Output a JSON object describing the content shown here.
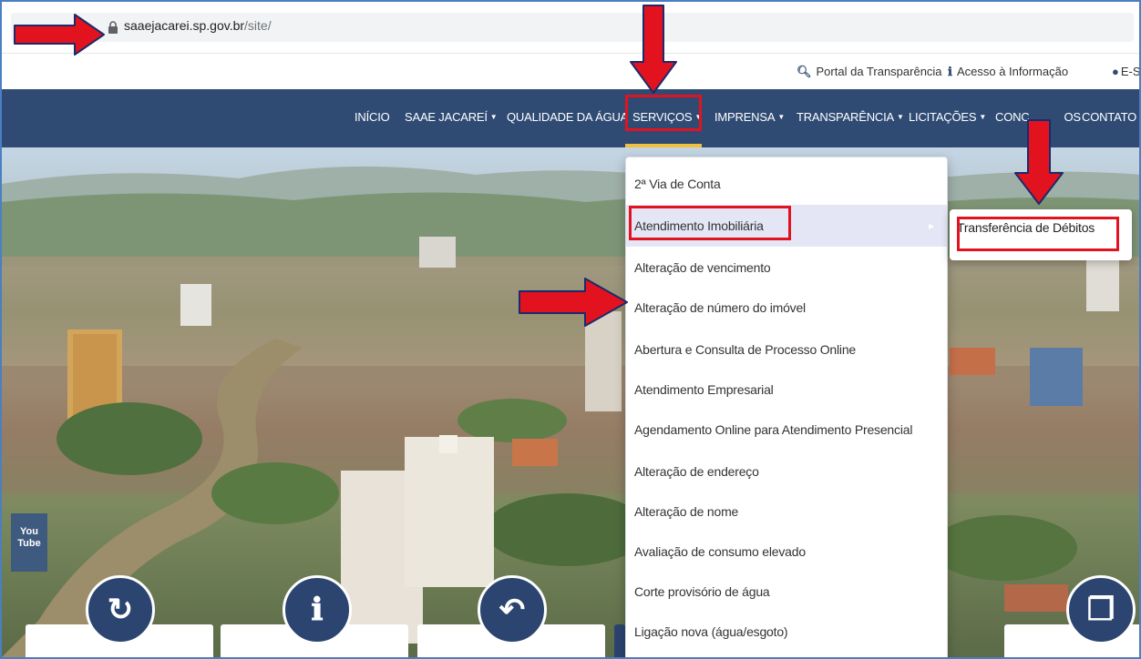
{
  "browser": {
    "url_host": "saaejacarei.sp.gov.br",
    "url_path": "/site/"
  },
  "utility_bar": {
    "transparency_portal": "Portal da Transparência",
    "information_access": "Acesso à Informação",
    "esic": "E-SI"
  },
  "nav": {
    "items": [
      {
        "label": "INÍCIO"
      },
      {
        "label": "SAAE JACAREÍ"
      },
      {
        "label": "QUALIDADE DA ÁGUA"
      },
      {
        "label": "SERVIÇOS"
      },
      {
        "label": "IMPRENSA"
      },
      {
        "label": "TRANSPARÊNCIA"
      },
      {
        "label": "LICITAÇÕES"
      },
      {
        "label": "CONC"
      },
      {
        "label": "OS"
      },
      {
        "label": "CONTATO"
      }
    ]
  },
  "dropdown": {
    "items": [
      {
        "label": "2ª Via de Conta"
      },
      {
        "label": "Atendimento Imobiliária"
      },
      {
        "label": "Alteração de vencimento"
      },
      {
        "label": "Alteração de número do imóvel"
      },
      {
        "label": "Abertura e Consulta de Processo Online"
      },
      {
        "label": "Atendimento Empresarial"
      },
      {
        "label": "Agendamento Online para Atendimento Presencial"
      },
      {
        "label": "Alteração de endereço"
      },
      {
        "label": "Alteração de nome"
      },
      {
        "label": "Avaliação de consumo elevado"
      },
      {
        "label": "Corte provisório de água"
      },
      {
        "label": "Ligação nova (água/esgoto)"
      }
    ]
  },
  "submenu": {
    "label": "Transferência de Débitos"
  },
  "social": {
    "youtube_top": "You",
    "youtube_bottom": "Tube"
  },
  "colors": {
    "nav_bg": "#2f4b74",
    "accent_underline": "#f0c040",
    "annotation_red": "#e2131f",
    "circle_bg": "#2b4470"
  }
}
